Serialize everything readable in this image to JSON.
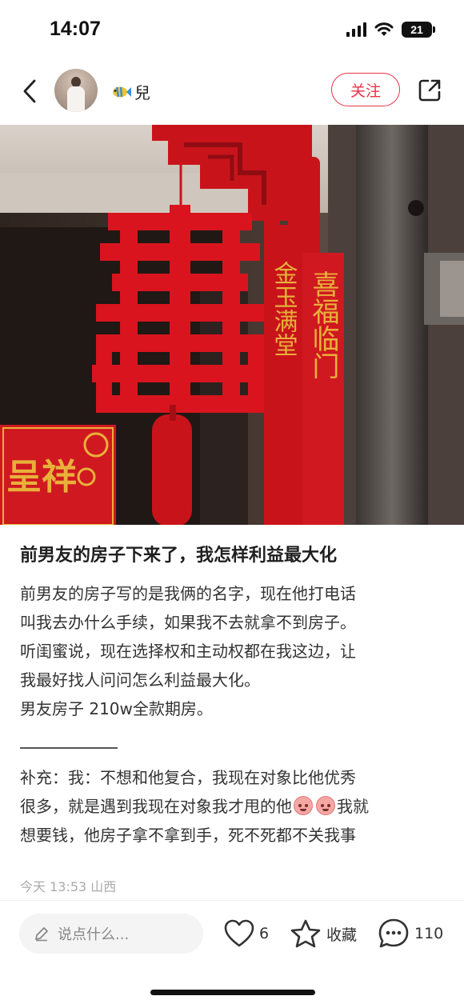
{
  "status_bar": {
    "time": "14:07",
    "battery": "21"
  },
  "header": {
    "username": "兒",
    "username_emoji_icon": "fish-icon",
    "follow_label": "关注"
  },
  "post": {
    "title": "前男友的房子下来了，我怎样利益最大化",
    "body_lines": [
      "前男友的房子写的是我俩的名字，现在他打电话",
      "叫我去办什么手续，如果我不去就拿不到房子。",
      "听闺蜜说，现在选择权和主动权都在我这边，让",
      "我最好找人问问怎么利益最大化。",
      "男友房子 210w全款期房。"
    ],
    "supplement_lines": {
      "line1": "补充：我：不想和他复合，我现在对象比他优秀",
      "line2_before": "很多，就是遇到我现在对象我才甩的他",
      "line2_after": "我就",
      "line3": "想要钱，他房子拿不拿到手，死不死都不关我事"
    },
    "meta": "今天 13:53 山西"
  },
  "photo": {
    "sign_left_text": "呈祥",
    "scroll_text_1": "金玉满堂",
    "scroll_text_2": "喜福临门"
  },
  "bottom_bar": {
    "comment_placeholder": "说点什么...",
    "like_count": "6",
    "collect_label": "收藏",
    "comment_count": "110"
  },
  "colors": {
    "accent": "#e83347",
    "photo_red": "#d9141e",
    "gold": "#e8b13a"
  }
}
